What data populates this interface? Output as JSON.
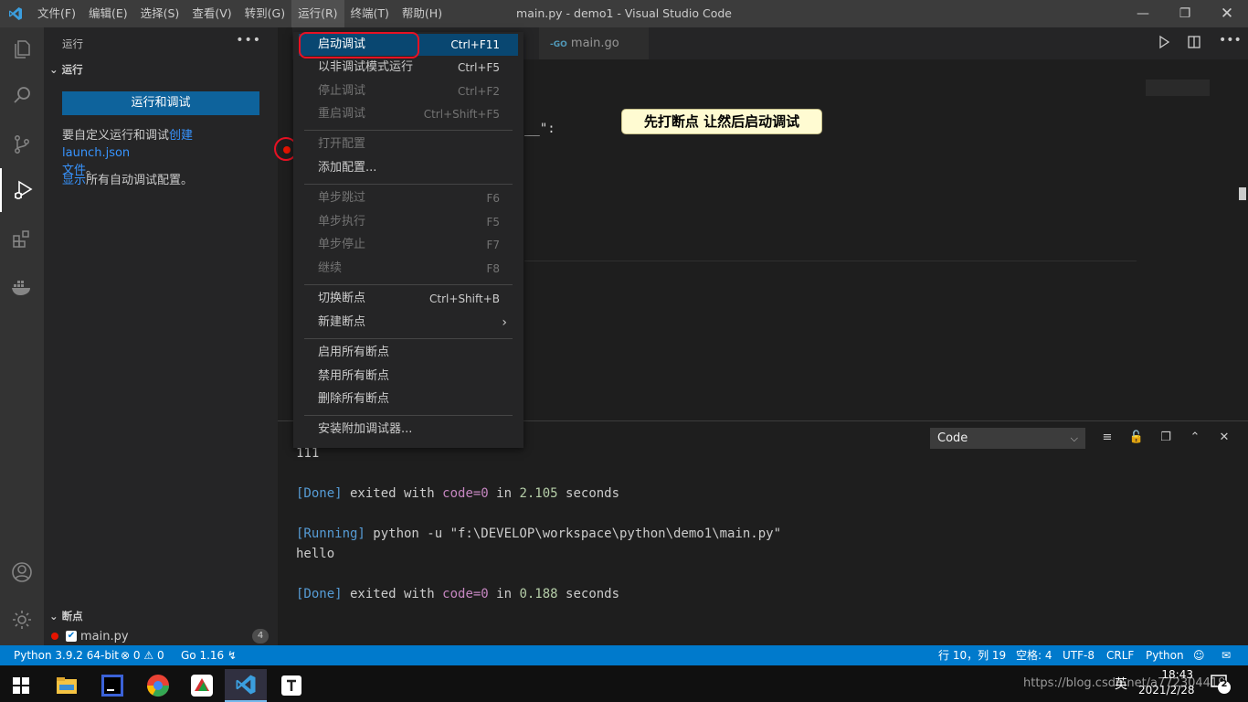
{
  "window": {
    "title": "main.py - demo1 - Visual Studio Code",
    "menus": [
      "文件(F)",
      "编辑(E)",
      "选择(S)",
      "查看(V)",
      "转到(G)",
      "运行(R)",
      "终端(T)",
      "帮助(H)"
    ],
    "active_menu": "运行(R)"
  },
  "sidebar": {
    "title": "运行",
    "section": "运行",
    "run_button": "运行和调试",
    "customize_prefix": "要自定义运行和调试",
    "create_link": "创建 launch.json",
    "file_suffix": "文件",
    "period": "。",
    "show_link": "显示",
    "show_suffix": "所有自动调试配置。",
    "breakpoints_section": "断点",
    "breakpoint_file": "main.py",
    "breakpoint_count": "4"
  },
  "editor": {
    "tab_label": "main.go",
    "code_fragment": "__\":",
    "callout": "先打断点 让然后启动调试"
  },
  "run_menu": {
    "items": [
      {
        "label": "启动调试",
        "key": "Ctrl+F11",
        "disabled": false
      },
      {
        "label": "以非调试模式运行",
        "key": "Ctrl+F5",
        "disabled": false
      },
      {
        "label": "停止调试",
        "key": "Ctrl+F2",
        "disabled": true
      },
      {
        "label": "重启调试",
        "key": "Ctrl+Shift+F5",
        "disabled": true
      },
      {
        "label": "打开配置",
        "key": "",
        "disabled": true
      },
      {
        "label": "添加配置...",
        "key": "",
        "disabled": false
      },
      {
        "label": "单步跳过",
        "key": "F6",
        "disabled": true
      },
      {
        "label": "单步执行",
        "key": "F5",
        "disabled": true
      },
      {
        "label": "单步停止",
        "key": "F7",
        "disabled": true
      },
      {
        "label": "继续",
        "key": "F8",
        "disabled": true
      },
      {
        "label": "切换断点",
        "key": "Ctrl+Shift+B",
        "disabled": false
      },
      {
        "label": "新建断点",
        "key": "",
        "disabled": false
      },
      {
        "label": "启用所有断点",
        "key": "",
        "disabled": false
      },
      {
        "label": "禁用所有断点",
        "key": "",
        "disabled": false
      },
      {
        "label": "删除所有断点",
        "key": "",
        "disabled": false
      },
      {
        "label": "安装附加调试器...",
        "key": "",
        "disabled": false
      }
    ]
  },
  "panel": {
    "output_select": "Code",
    "lines": [
      {
        "text": "111",
        "color": "#cccccc"
      },
      {
        "text": "",
        "color": "#cccccc"
      },
      {
        "parts": [
          {
            "text": "[Done]",
            "color": "#569cd6"
          },
          {
            "text": " exited with ",
            "color": "#cccccc"
          },
          {
            "text": "code=0",
            "color": "#c586c0"
          },
          {
            "text": " in ",
            "color": "#cccccc"
          },
          {
            "text": "2.105",
            "color": "#b5cea8"
          },
          {
            "text": " seconds",
            "color": "#cccccc"
          }
        ]
      },
      {
        "text": "",
        "color": "#cccccc"
      },
      {
        "parts": [
          {
            "text": "[Running]",
            "color": "#569cd6"
          },
          {
            "text": " python -u \"f:\\DEVELOP\\workspace\\python\\demo1\\main.py\"",
            "color": "#cccccc"
          }
        ]
      },
      {
        "text": "hello",
        "color": "#cccccc"
      },
      {
        "text": "",
        "color": "#cccccc"
      },
      {
        "parts": [
          {
            "text": "[Done]",
            "color": "#569cd6"
          },
          {
            "text": " exited with ",
            "color": "#cccccc"
          },
          {
            "text": "code=0",
            "color": "#c586c0"
          },
          {
            "text": " in ",
            "color": "#cccccc"
          },
          {
            "text": "0.188",
            "color": "#b5cea8"
          },
          {
            "text": " seconds",
            "color": "#cccccc"
          }
        ]
      }
    ]
  },
  "statusbar": {
    "python": "Python 3.9.2 64-bit",
    "errors": "0",
    "warnings": "0",
    "go": "Go 1.16",
    "position": "行 10，列 19",
    "spaces": "空格: 4",
    "encoding": "UTF-8",
    "eol": "CRLF",
    "language": "Python"
  },
  "taskbar": {
    "time": "18:43",
    "date": "2021/2/28",
    "ime": "英",
    "notifications": "2",
    "watermark": "https://blog.csdn.net/a772304419"
  }
}
